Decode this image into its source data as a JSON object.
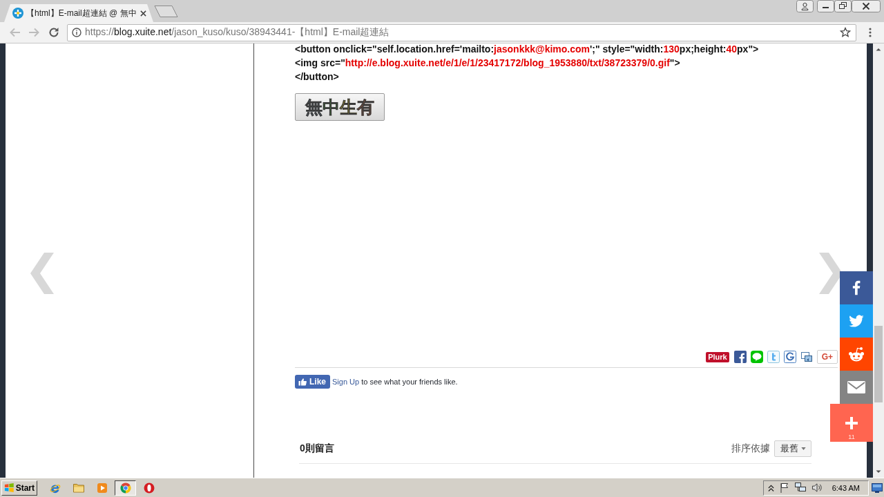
{
  "browser": {
    "tabs": [
      {
        "title": "【html】E-mail超連結 @ 無中",
        "selected": true
      }
    ],
    "toolbar": {
      "back": {
        "disabled": true
      },
      "forward": {
        "disabled": true
      },
      "url": {
        "scheme": "https://",
        "host": "blog.xuite.net",
        "path": "/jason_kuso/kuso/38943441-【html】E-mail超連結"
      }
    }
  },
  "article": {
    "code_lines": [
      [
        {
          "kind": "code",
          "text": "<button onclick=\"self.location.href='mailto:"
        },
        {
          "kind": "value",
          "text": "jasonkkk@kimo.com"
        },
        {
          "kind": "code",
          "text": "';\" style=\"width:"
        },
        {
          "kind": "value",
          "text": "130"
        },
        {
          "kind": "code",
          "text": "px;height:"
        },
        {
          "kind": "value",
          "text": "40"
        },
        {
          "kind": "code",
          "text": "px\">"
        }
      ],
      [
        {
          "kind": "code",
          "text": "<img src=\""
        },
        {
          "kind": "value",
          "text": "http://e.blog.xuite.net/e/1/e/1/23417172/blog_1953880/txt/38723379/0.gif"
        },
        {
          "kind": "code",
          "text": "\">"
        }
      ],
      [
        {
          "kind": "code",
          "text": "</button>"
        }
      ]
    ],
    "demo_button": {
      "label": "無中生有"
    },
    "share_buttons": [
      {
        "kind": "plurk",
        "label": "Plurk"
      },
      {
        "kind": "facebook"
      },
      {
        "kind": "line"
      },
      {
        "kind": "twitter"
      },
      {
        "kind": "google"
      },
      {
        "kind": "bookmark"
      },
      {
        "kind": "gplus",
        "label": "G+"
      }
    ],
    "like_box": {
      "button": "Like",
      "link": "Sign Up",
      "text": "to see what your friends like."
    },
    "comments": {
      "count": "0則留言",
      "sort_label": "排序依據",
      "sort_value": "最舊"
    }
  },
  "floating_share": [
    {
      "kind": "facebook"
    },
    {
      "kind": "twitter"
    },
    {
      "kind": "reddit"
    },
    {
      "kind": "email"
    },
    {
      "kind": "more",
      "count": "11"
    }
  ],
  "taskbar": {
    "start": "Start",
    "apps": [
      {
        "kind": "ie",
        "selected": false
      },
      {
        "kind": "folder",
        "selected": false
      },
      {
        "kind": "media",
        "selected": false
      },
      {
        "kind": "chrome",
        "selected": true
      },
      {
        "kind": "opera",
        "selected": false
      }
    ],
    "clock": "6:43 AM"
  }
}
